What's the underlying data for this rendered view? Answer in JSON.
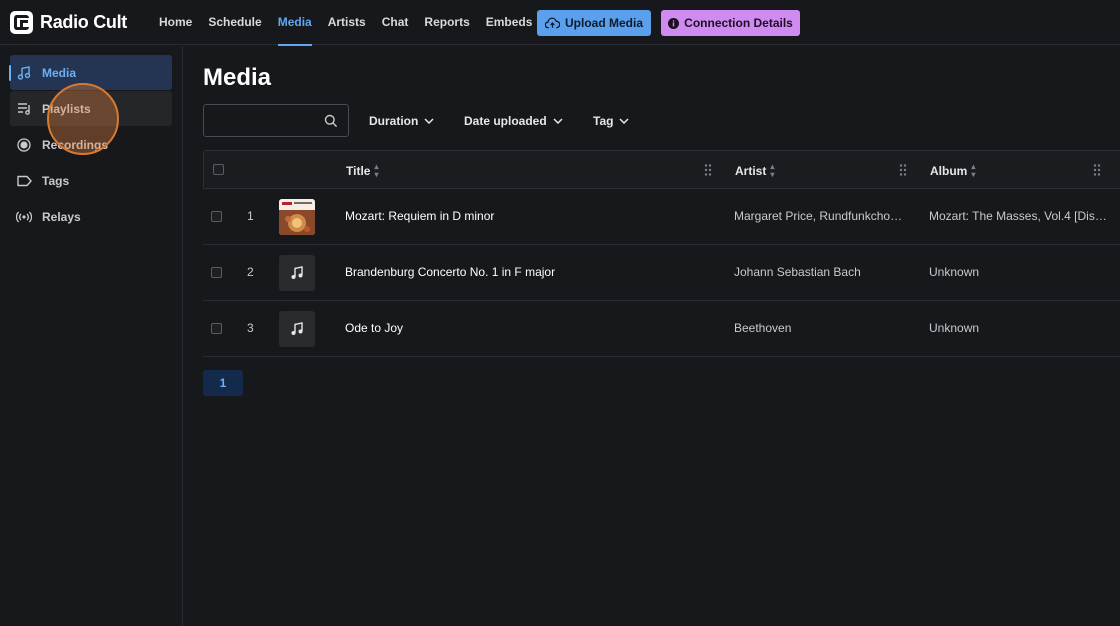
{
  "app": {
    "name": "Radio Cult"
  },
  "nav": {
    "items": [
      {
        "label": "Home",
        "active": false
      },
      {
        "label": "Schedule",
        "active": false
      },
      {
        "label": "Media",
        "active": true
      },
      {
        "label": "Artists",
        "active": false
      },
      {
        "label": "Chat",
        "active": false
      },
      {
        "label": "Reports",
        "active": false
      },
      {
        "label": "Embeds",
        "active": false
      }
    ],
    "upload_label": "Upload Media",
    "connection_label": "Connection Details"
  },
  "sidebar": {
    "items": [
      {
        "label": "Media",
        "icon": "music-note-icon"
      },
      {
        "label": "Playlists",
        "icon": "playlist-icon"
      },
      {
        "label": "Recordings",
        "icon": "record-icon"
      },
      {
        "label": "Tags",
        "icon": "tag-icon"
      },
      {
        "label": "Relays",
        "icon": "broadcast-icon"
      }
    ]
  },
  "main": {
    "title": "Media",
    "search": {
      "value": "",
      "placeholder": ""
    },
    "filters": {
      "duration": "Duration",
      "date_uploaded": "Date uploaded",
      "tag": "Tag"
    },
    "columns": {
      "title": "Title",
      "artist": "Artist",
      "album": "Album"
    },
    "rows": [
      {
        "num": "1",
        "title": "Mozart: Requiem in D minor",
        "artist": "Margaret Price, Rundfunkchor…",
        "album": "Mozart: The Masses, Vol.4 [Dis…",
        "thumb": "album-art"
      },
      {
        "num": "2",
        "title": "Brandenburg Concerto No. 1 in F major",
        "artist": "Johann Sebastian Bach",
        "album": "Unknown",
        "thumb": "music-note-icon"
      },
      {
        "num": "3",
        "title": "Ode to Joy",
        "artist": "Beethoven",
        "album": "Unknown",
        "thumb": "music-note-icon"
      }
    ],
    "pagination": {
      "current": "1"
    }
  },
  "colors": {
    "accent": "#63a6f0",
    "upload": "#5aa0ec",
    "connection": "#cf8bf0",
    "background": "#17181c"
  }
}
